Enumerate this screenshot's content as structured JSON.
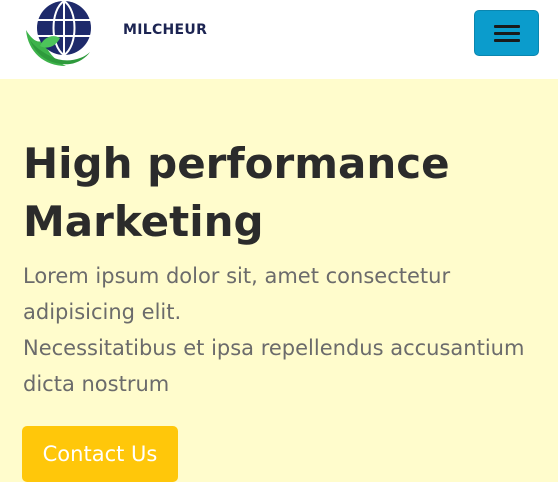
{
  "navbar": {
    "brand_name": "MILCHEUR",
    "menu_icon": "hamburger-menu-icon",
    "logo_icon": "globe-leaf-logo-icon",
    "menu_button_color": "#0b9ccc"
  },
  "hero": {
    "title_line_1": "High performance",
    "title_line_2": "Marketing",
    "paragraph_line_1": "Lorem ipsum dolor sit, amet consectetur adipisicing elit.",
    "paragraph_line_2": "Necessitatibus et ipsa repellendus accusantium dicta nostrum",
    "cta_label": "Contact Us",
    "background_color": "#fffccc",
    "cta_color": "#ffc70a"
  }
}
